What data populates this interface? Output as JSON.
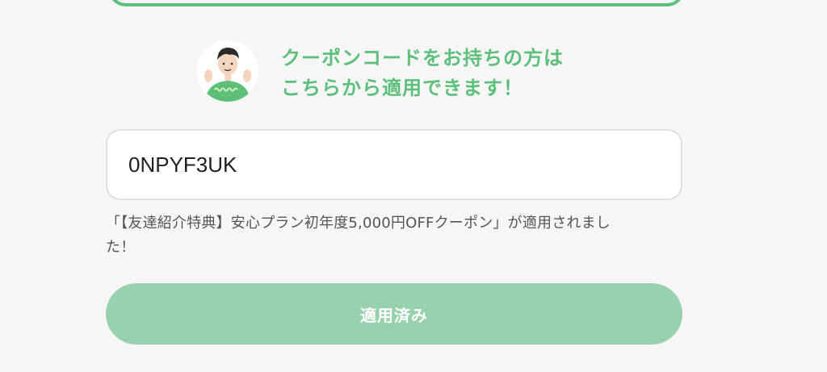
{
  "promo": {
    "line1": "クーポンコードをお持ちの方は",
    "line2": "こちらから適用できます！"
  },
  "avatar": {
    "icon": "person-avatar-icon"
  },
  "coupon": {
    "value": "0NPYF3UK"
  },
  "status": {
    "line1": "「【友達紹介特典】安心プラン初年度5,000円OFFクーポン」が適用されまし",
    "line2": "た！"
  },
  "apply_button": {
    "label": "適用済み"
  },
  "colors": {
    "accent": "#5cbf7a",
    "button_disabled": "#98d1ad",
    "background": "#f6f6f6",
    "input_border": "#e0e0e0"
  }
}
